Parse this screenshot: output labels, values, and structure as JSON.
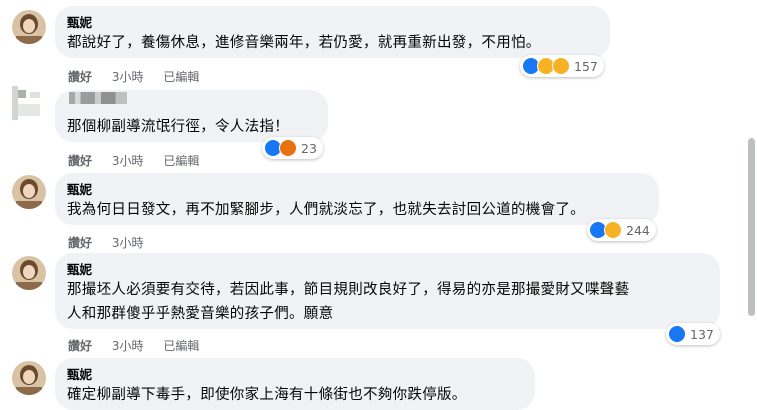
{
  "actions": {
    "like": "讚好",
    "edited": "已編輯"
  },
  "comments": [
    {
      "author": "甄妮",
      "text": [
        "都說好了，養傷休息，進修音樂兩年，若仍愛，就再重新出發，不用怕。"
      ],
      "time": "3小時",
      "edited": true,
      "reactions": [
        "like",
        "sad",
        "care"
      ],
      "count": "157"
    },
    {
      "author": "",
      "text": [
        "那個柳副導流氓行徑，令人法指！"
      ],
      "time": "3小時",
      "edited": true,
      "reactions": [
        "like",
        "angry"
      ],
      "count": "23"
    },
    {
      "author": "甄妮",
      "text": [
        "我為何日日發文，再不加緊腳步，人們就淡忘了，也就失去討回公道的機會了。"
      ],
      "time": "3小時",
      "edited": false,
      "reactions": [
        "like",
        "care"
      ],
      "count": "244"
    },
    {
      "author": "甄妮",
      "text": [
        "那撮坯人必須要有交待，若因此事，節目規則改良好了，得易的亦是那撮愛財又喋聲藝",
        "人和那群傻乎乎熱愛音樂的孩子們。願意"
      ],
      "time": "3小時",
      "edited": true,
      "reactions": [
        "like"
      ],
      "count": "137"
    },
    {
      "author": "甄妮",
      "text": [
        "確定柳副導下毒手，即使你家上海有十條街也不夠你跌停版。"
      ],
      "time": "",
      "edited": false,
      "reactions": [],
      "count": ""
    }
  ]
}
